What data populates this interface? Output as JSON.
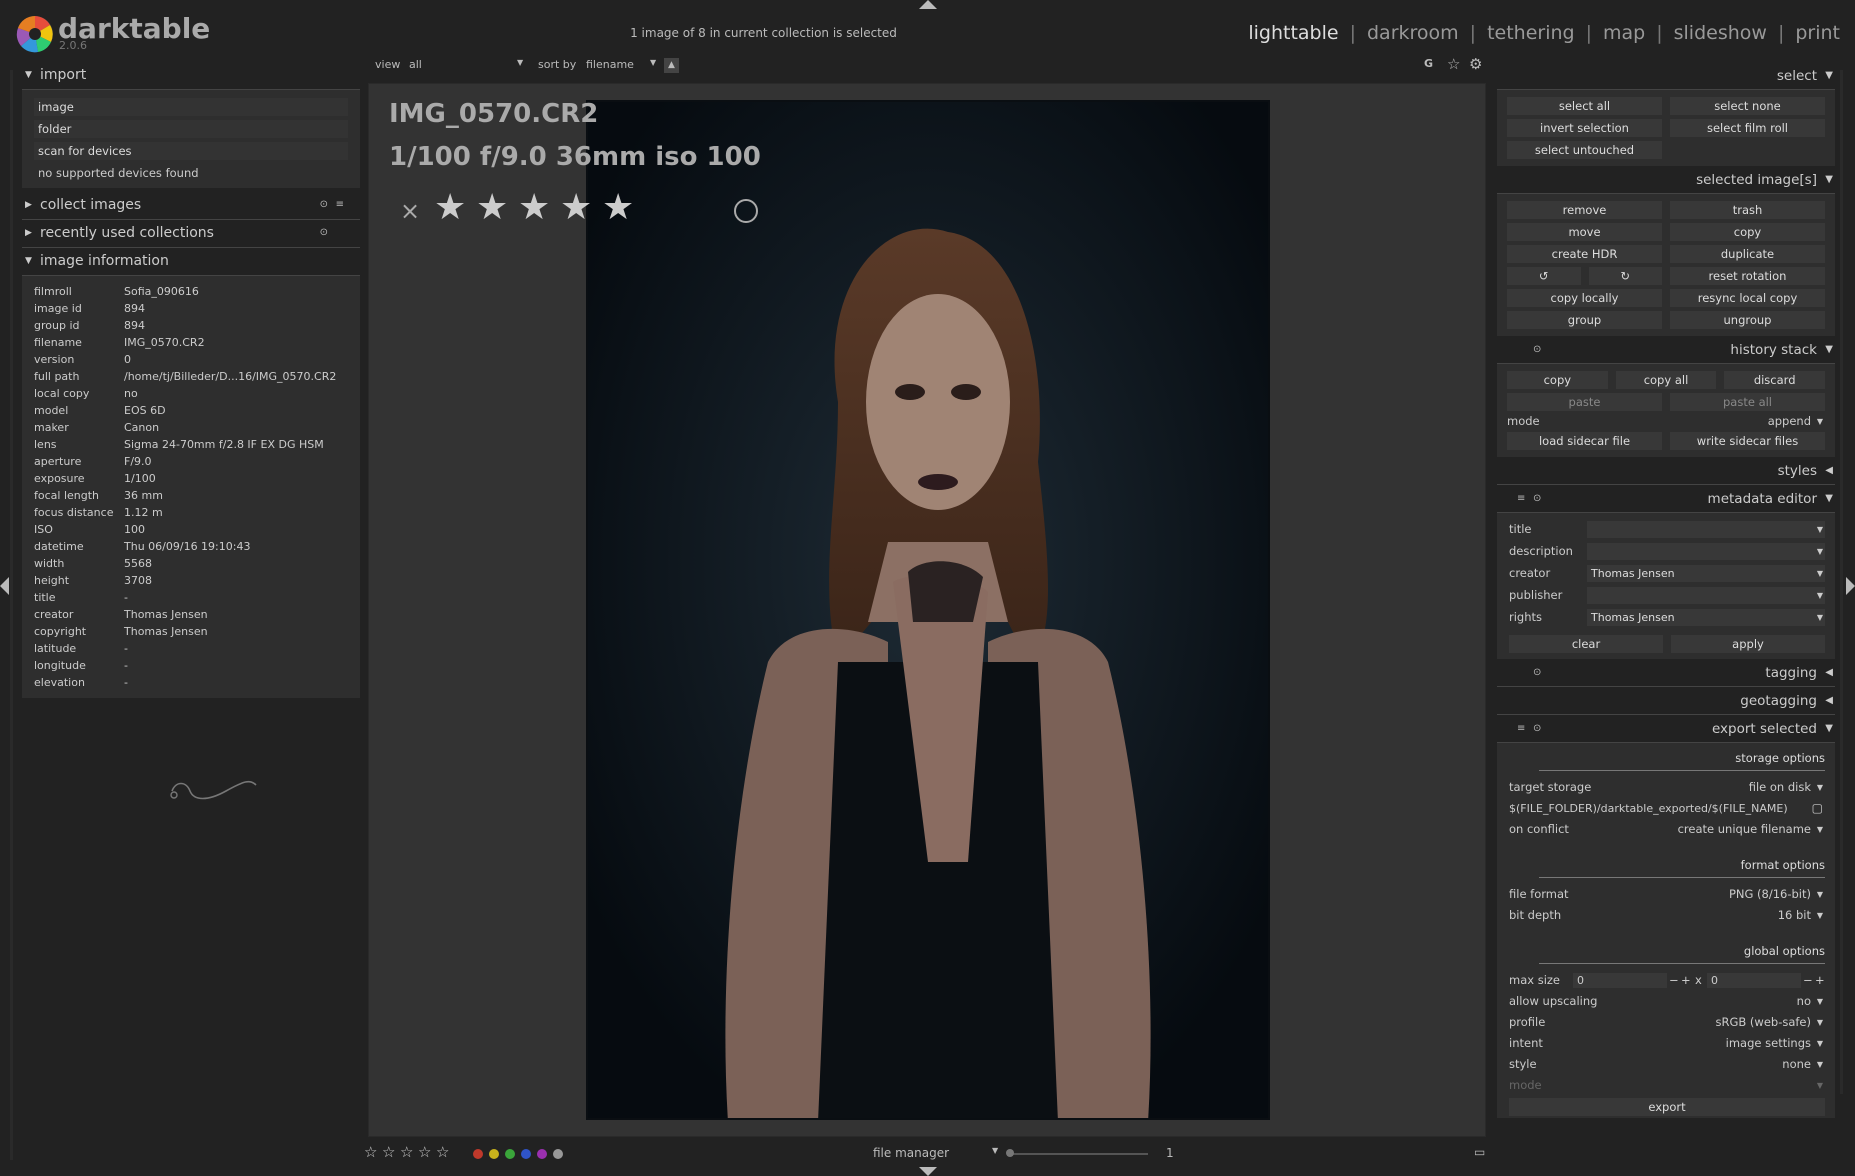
{
  "header": {
    "app_name": "darktable",
    "version": "2.0.6",
    "status": "1 image of 8 in current collection is selected",
    "views": [
      "lighttable",
      "darkroom",
      "tethering",
      "map",
      "slideshow",
      "print"
    ],
    "active_view": "lighttable"
  },
  "import": {
    "title": "import",
    "buttons": [
      "image",
      "folder",
      "scan for devices"
    ],
    "no_devices": "no supported devices found"
  },
  "collect": {
    "title": "collect images"
  },
  "recent": {
    "title": "recently used collections"
  },
  "image_info": {
    "title": "image information",
    "rows": [
      {
        "k": "filmroll",
        "v": "Sofia_090616"
      },
      {
        "k": "image id",
        "v": "894"
      },
      {
        "k": "group id",
        "v": "894"
      },
      {
        "k": "filename",
        "v": "IMG_0570.CR2"
      },
      {
        "k": "version",
        "v": "0"
      },
      {
        "k": "full path",
        "v": "/home/tj/Billeder/D...16/IMG_0570.CR2"
      },
      {
        "k": "local copy",
        "v": "no"
      },
      {
        "k": "model",
        "v": "EOS 6D"
      },
      {
        "k": "maker",
        "v": "Canon"
      },
      {
        "k": "lens",
        "v": "Sigma 24-70mm f/2.8 IF EX DG HSM"
      },
      {
        "k": "aperture",
        "v": "F/9.0"
      },
      {
        "k": "exposure",
        "v": "1/100"
      },
      {
        "k": "focal length",
        "v": "36 mm"
      },
      {
        "k": "focus distance",
        "v": "1.12 m"
      },
      {
        "k": "ISO",
        "v": "100"
      },
      {
        "k": "datetime",
        "v": "Thu 06/09/16 19:10:43"
      },
      {
        "k": "width",
        "v": "5568"
      },
      {
        "k": "height",
        "v": "3708"
      },
      {
        "k": "title",
        "v": "-"
      },
      {
        "k": "creator",
        "v": "Thomas Jensen"
      },
      {
        "k": "copyright",
        "v": "Thomas Jensen"
      },
      {
        "k": "latitude",
        "v": "-"
      },
      {
        "k": "longitude",
        "v": "-"
      },
      {
        "k": "elevation",
        "v": "-"
      }
    ]
  },
  "toolbar": {
    "view_label": "view",
    "view_value": "all",
    "sort_label": "sort by",
    "sort_value": "filename",
    "g": "G"
  },
  "preview": {
    "filename": "IMG_0570.CR2",
    "exif": "1/100 f/9.0 36mm iso 100",
    "reject": "×",
    "stars": 5
  },
  "bottom": {
    "mode": "file manager",
    "zoom": "1",
    "color_labels": [
      "#c0392b",
      "#c9b21c",
      "#3aa53a",
      "#2f54c9",
      "#9b30b0",
      "#999999"
    ]
  },
  "select": {
    "title": "select",
    "buttons": [
      "select all",
      "select none",
      "invert selection",
      "select film roll",
      "select untouched"
    ]
  },
  "selected": {
    "title": "selected image[s]",
    "buttons": [
      "remove",
      "trash",
      "move",
      "copy",
      "create HDR",
      "duplicate"
    ],
    "reset_rotation": "reset rotation",
    "buttons2": [
      "copy locally",
      "resync local copy",
      "group",
      "ungroup"
    ]
  },
  "history": {
    "title": "history stack",
    "row1": [
      "copy",
      "copy all",
      "discard"
    ],
    "row2": [
      "paste",
      "paste all"
    ],
    "mode_label": "mode",
    "mode_value": "append",
    "row3": [
      "load sidecar file",
      "write sidecar files"
    ]
  },
  "styles": {
    "title": "styles"
  },
  "metadata": {
    "title": "metadata editor",
    "fields": [
      {
        "k": "title",
        "v": ""
      },
      {
        "k": "description",
        "v": ""
      },
      {
        "k": "creator",
        "v": "Thomas Jensen"
      },
      {
        "k": "publisher",
        "v": ""
      },
      {
        "k": "rights",
        "v": "Thomas Jensen"
      }
    ],
    "clear": "clear",
    "apply": "apply"
  },
  "tagging": {
    "title": "tagging"
  },
  "geotagging": {
    "title": "geotagging"
  },
  "export": {
    "title": "export selected",
    "storage_h": "storage options",
    "target_label": "target storage",
    "target_value": "file on disk",
    "path": "$(FILE_FOLDER)/darktable_exported/$(FILE_NAME)",
    "conflict_label": "on conflict",
    "conflict_value": "create unique filename",
    "format_h": "format options",
    "file_format_label": "file format",
    "file_format_value": "PNG (8/16-bit)",
    "bit_depth_label": "bit depth",
    "bit_depth_value": "16 bit",
    "global_h": "global options",
    "max_size_label": "max size",
    "max_w": "0",
    "max_h": "0",
    "x": "x",
    "upscale_label": "allow upscaling",
    "upscale_value": "no",
    "profile_label": "profile",
    "profile_value": "sRGB (web-safe)",
    "intent_label": "intent",
    "intent_value": "image settings",
    "style_label": "style",
    "style_value": "none",
    "mode_label": "mode",
    "export_btn": "export"
  }
}
